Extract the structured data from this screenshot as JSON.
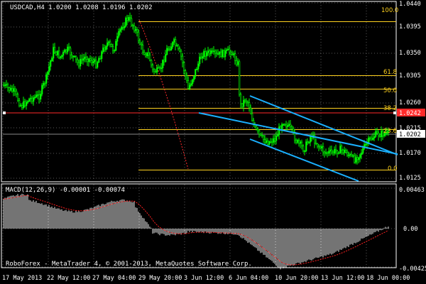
{
  "header": {
    "symbol_line": "USDCAD,H4  1.0200 1.0208 1.0196 1.0202"
  },
  "footer": {
    "copyright": "RoboForex - MetaTrader 4, © 2001-2013, MetaQuotes Software Corp."
  },
  "colors": {
    "background": "#000000",
    "grid": "#5a5a5a",
    "bull_candle": "#00ff00",
    "fib_lines": "#ffd21f",
    "channel": "#1ab0ff",
    "red_level": "#ff2a2a",
    "bid_line": "#c0c0c0",
    "macd_histogram": "#e8e8e8",
    "macd_signal": "#ff2020"
  },
  "price_axis": {
    "labels": [
      "1.0440",
      "1.0395",
      "1.0350",
      "1.0305",
      "1.0260",
      "1.0215",
      "1.0170",
      "1.0125"
    ],
    "current_red_tag": "1.0242",
    "current_bid_tag": "1.0202"
  },
  "time_axis": {
    "labels": [
      "17 May 2013",
      "22 May 12:00",
      "27 May 04:00",
      "29 May 20:00",
      "3 Jun 12:00",
      "6 Jun 04:00",
      "10 Jun 20:00",
      "13 Jun 12:00",
      "18 Jun 00:00"
    ]
  },
  "fibonacci": [
    {
      "label": "100.0"
    },
    {
      "label": "61.8"
    },
    {
      "label": "50.0"
    },
    {
      "label": "38.2"
    },
    {
      "label": "23.6"
    },
    {
      "label": "0.0"
    }
  ],
  "macd": {
    "title": "MACD(12,26,9) -0.00001 -0.00074",
    "axis_labels": [
      "0.00463",
      "0.00",
      "-0.00425"
    ]
  },
  "chart_data": {
    "type": "candlestick",
    "symbol": "USDCAD",
    "timeframe": "H4",
    "ylim": [
      1.011,
      1.0445
    ],
    "fib_levels": [
      1.041,
      1.0309,
      1.0284,
      1.0248,
      1.0208,
      1.0132
    ],
    "red_level": 1.0242,
    "bid": 1.0202,
    "ohlc_last": {
      "open": 1.02,
      "high": 1.0208,
      "low": 1.0196,
      "close": 1.0202
    },
    "channel_upper": [
      [
        280,
        1.0249
      ],
      [
        560,
        1.0168
      ]
    ],
    "channel_lower_start": [
      352,
      1.027
    ],
    "channel_lower_end": [
      505,
      1.0128
    ],
    "channel_upper_parallel": [
      [
        352,
        1.027
      ],
      [
        560,
        1.0168
      ]
    ],
    "macd_range": [
      -0.00425,
      0.00463
    ]
  }
}
